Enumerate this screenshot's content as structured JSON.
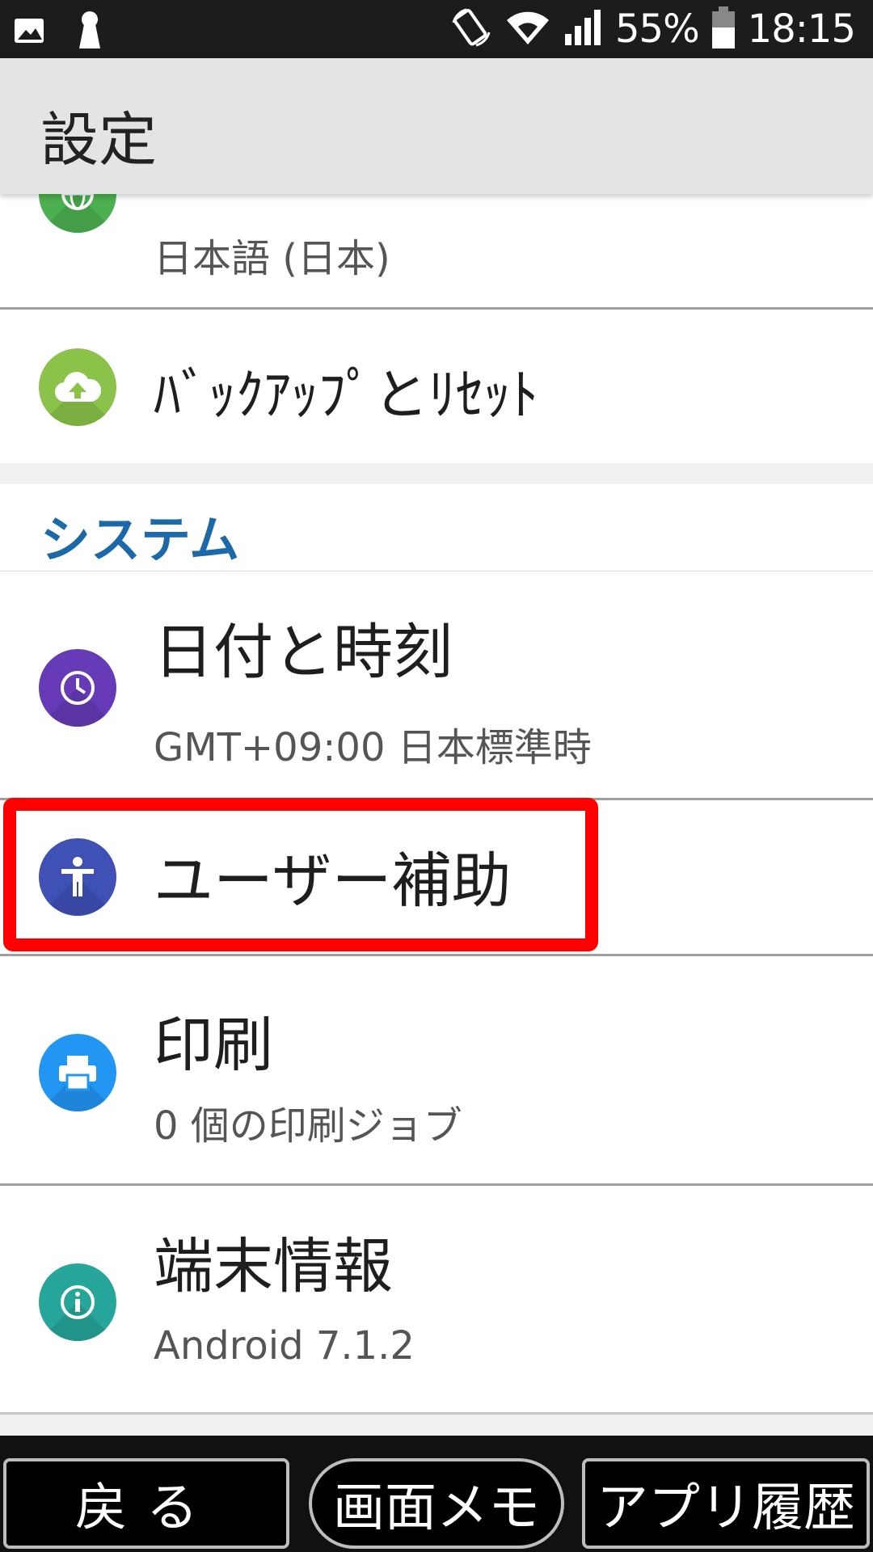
{
  "status_bar": {
    "battery": "55%",
    "time": "18:15"
  },
  "app_bar": {
    "title": "設定"
  },
  "settings": {
    "language_subtitle": "日本語 (日本)",
    "backup_title": "ﾊﾞｯｸｱｯﾌﾟとﾘｾｯﾄ",
    "section_system": "システム",
    "datetime_title": "日付と時刻",
    "datetime_subtitle": "GMT+09:00 日本標準時",
    "accessibility_title": "ユーザー補助",
    "print_title": "印刷",
    "print_subtitle": "0 個の印刷ジョブ",
    "device_title": "端末情報",
    "device_subtitle": "Android 7.1.2"
  },
  "icons": {
    "language": "globe-icon",
    "backup": "cloud-upload-icon",
    "datetime": "clock-icon",
    "accessibility": "accessibility-icon",
    "print": "printer-icon",
    "device": "info-icon"
  },
  "colors": {
    "language": "#4caf50",
    "backup": "#8bc34a",
    "datetime": "#673ab7",
    "accessibility": "#3f51b5",
    "print": "#2196f3",
    "device": "#26a69a",
    "section_header": "#1b69a8",
    "highlight": "#ff0000"
  },
  "bottom_nav": {
    "back": "戻る",
    "screen_memo": "画面メモ",
    "app_history": "アプリ履歴"
  }
}
